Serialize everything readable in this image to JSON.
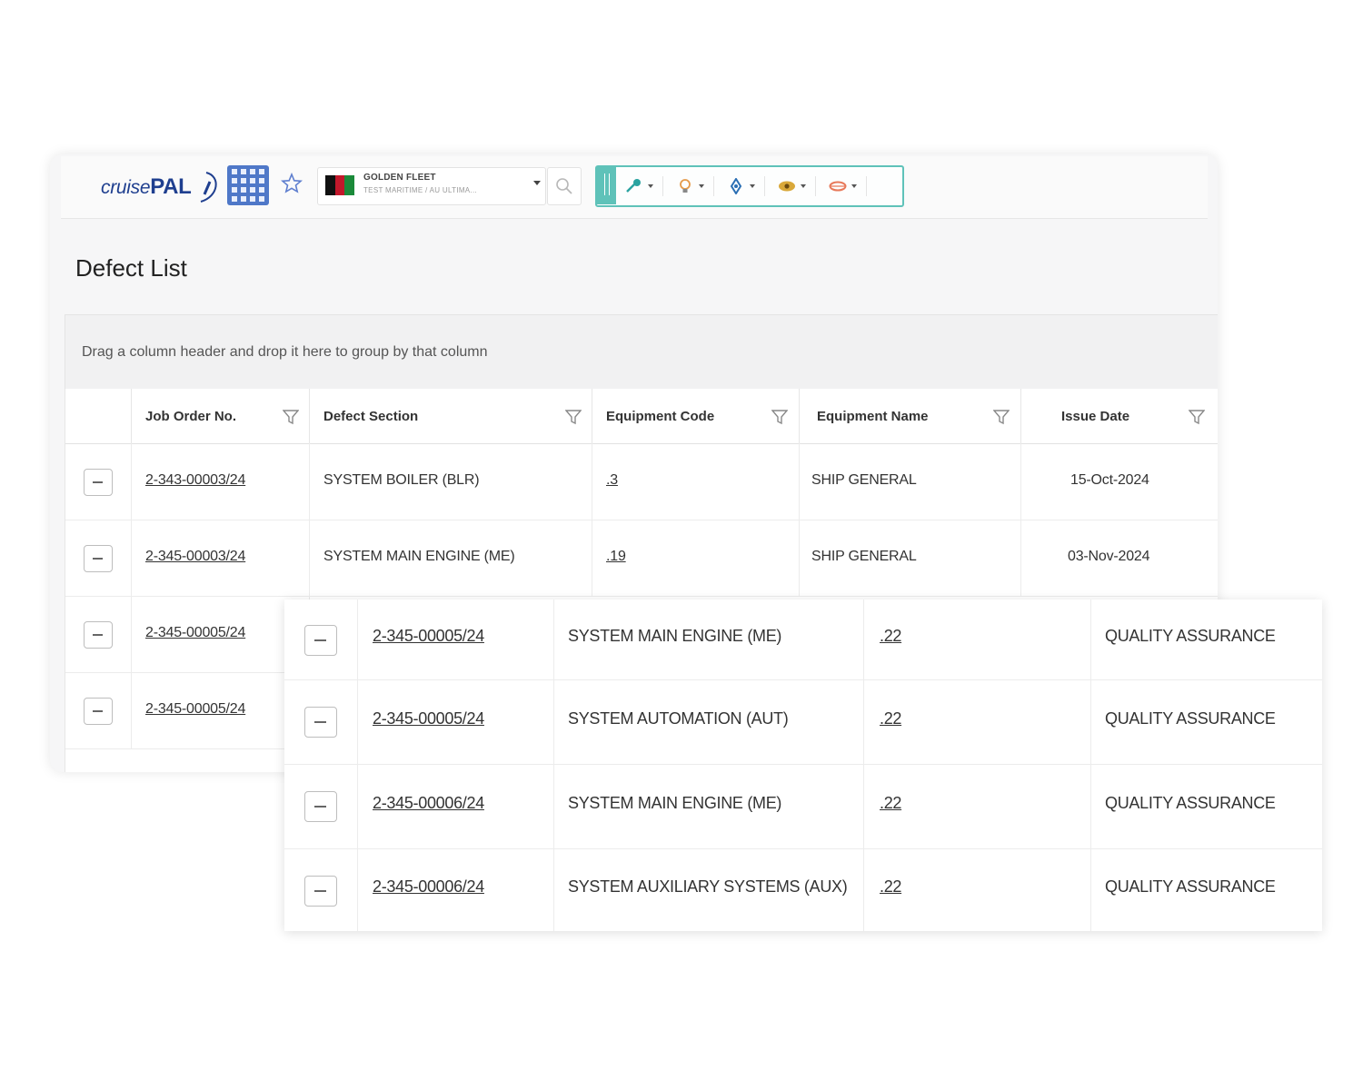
{
  "app": {
    "logo_prefix": "cruise",
    "logo_suffix": "PAL",
    "vessel": {
      "name": "GOLDEN FLEET",
      "sub": "TEST MARITIME  /  AU ULTIMA..."
    }
  },
  "page": {
    "title": "Defect List",
    "group_hint": "Drag a column header and drop it here to group by that column"
  },
  "grid": {
    "columns": [
      "Job Order No.",
      "Defect Section",
      "Equipment Code",
      "Equipment Name",
      "Issue Date"
    ],
    "rows": [
      {
        "job": "2-343-00003/24",
        "section": "SYSTEM BOILER (BLR)",
        "code": ".3",
        "name": "SHIP GENERAL",
        "date": "15-Oct-2024"
      },
      {
        "job": "2-345-00003/24",
        "section": "SYSTEM MAIN ENGINE (ME)",
        "code": ".19",
        "name": "SHIP GENERAL",
        "date": "03-Nov-2024"
      },
      {
        "job": "2-345-00005/24"
      },
      {
        "job": "2-345-00005/24"
      }
    ]
  },
  "front_grid": {
    "rows": [
      {
        "job": "2-345-00005/24",
        "section": "SYSTEM MAIN ENGINE (ME)",
        "code": ".22",
        "name": "QUALITY ASSURANCE"
      },
      {
        "job": "2-345-00005/24",
        "section": "SYSTEM AUTOMATION (AUT)",
        "code": ".22",
        "name": "QUALITY ASSURANCE"
      },
      {
        "job": "2-345-00006/24",
        "section": "SYSTEM MAIN ENGINE (ME)",
        "code": ".22",
        "name": "QUALITY ASSURANCE"
      },
      {
        "job": "2-345-00006/24",
        "section": "SYSTEM AUXILIARY SYSTEMS (AUX)",
        "code": ".22",
        "name": "QUALITY ASSURANCE"
      }
    ]
  },
  "colors": {
    "brand": "#1f3f8f",
    "apps_button": "#4f78c8",
    "toolbar_accent": "#5fc2b9",
    "link": "#2f5fb3"
  },
  "icons": [
    "apps-grid-icon",
    "star-icon",
    "flag-icon",
    "search-icon",
    "grip-icon",
    "wrench-icon",
    "bulb-icon",
    "move-icon",
    "eye-icon",
    "lips-icon",
    "filter-icon",
    "minus-icon"
  ]
}
